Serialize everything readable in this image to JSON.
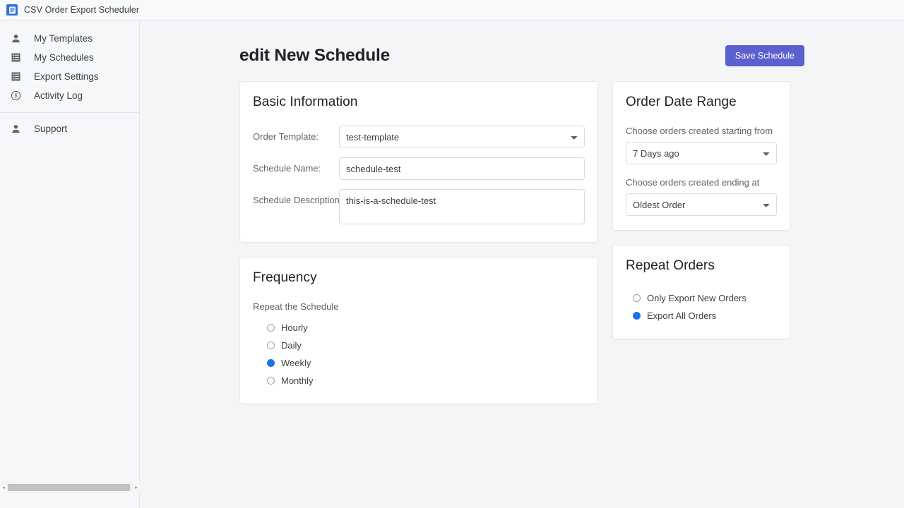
{
  "appbar": {
    "title": "CSV Order Export Scheduler",
    "logo_icon": "app-logo-icon"
  },
  "sidebar": {
    "items": [
      {
        "label": "My Templates",
        "icon": "person-icon"
      },
      {
        "label": "My Schedules",
        "icon": "list-box-icon"
      },
      {
        "label": "Export Settings",
        "icon": "list-box-icon"
      },
      {
        "label": "Activity Log",
        "icon": "dollar-circle-icon"
      }
    ],
    "secondary": [
      {
        "label": "Support",
        "icon": "person-icon"
      }
    ],
    "scrollbar": {
      "left_arrow": "◂",
      "right_arrow": "▸"
    }
  },
  "header": {
    "title": "edit New Schedule",
    "save_label": "Save Schedule",
    "save_color": "#5b5fd0"
  },
  "basic_information": {
    "title": "Basic Information",
    "order_template": {
      "label": "Order Template:",
      "value": "test-template",
      "options": [
        "test-template"
      ]
    },
    "schedule_name": {
      "label": "Schedule Name:",
      "value": "schedule-test",
      "placeholder": ""
    },
    "schedule_description": {
      "label": "Schedule Description:",
      "value": "this-is-a-schedule-test",
      "placeholder": ""
    }
  },
  "order_date_range": {
    "title": "Order Date Range",
    "start": {
      "label": "Choose orders created starting from",
      "value": "7 Days ago",
      "options": [
        "7 Days ago"
      ]
    },
    "end": {
      "label": "Choose orders created ending at",
      "value": "Oldest Order",
      "options": [
        "Oldest Order"
      ]
    }
  },
  "frequency": {
    "title": "Frequency",
    "sub_label": "Repeat the Schedule",
    "options": [
      {
        "label": "Hourly",
        "selected": false
      },
      {
        "label": "Daily",
        "selected": false
      },
      {
        "label": "Weekly",
        "selected": true
      },
      {
        "label": "Monthly",
        "selected": false
      }
    ],
    "selected_value": "Weekly"
  },
  "repeat_orders": {
    "title": "Repeat Orders",
    "options": [
      {
        "label": "Only Export New Orders",
        "selected": false
      },
      {
        "label": "Export All Orders",
        "selected": true
      }
    ],
    "selected_value": "Export All Orders"
  },
  "colors": {
    "accent": "#5b5fd0",
    "radio_selected": "#1a73e8",
    "page_bg": "#f4f5f7",
    "sidebar_bg": "#f6f7f9"
  }
}
